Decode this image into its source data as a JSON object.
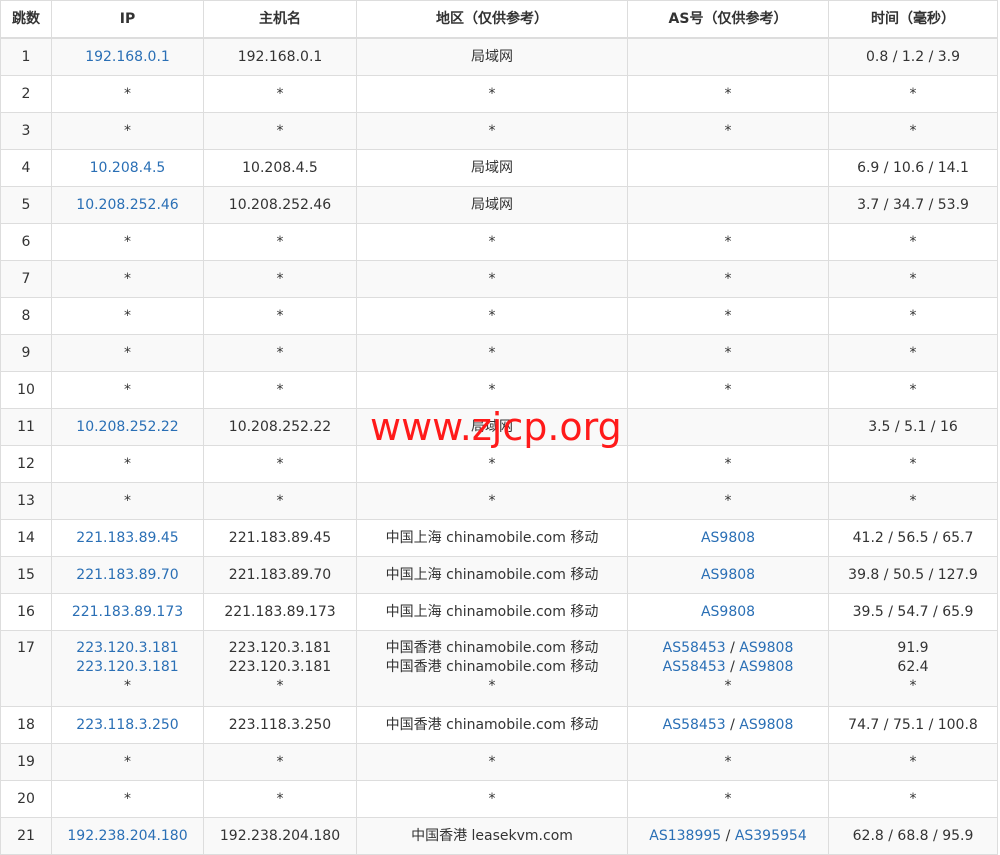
{
  "headers": [
    "跳数",
    "IP",
    "主机名",
    "地区（仅供参考）",
    "AS号（仅供参考）",
    "时间（毫秒）"
  ],
  "watermark": "www.zjcp.org",
  "rows": [
    {
      "hop": "1",
      "ips": [
        "192.168.0.1"
      ],
      "hosts": [
        "192.168.0.1"
      ],
      "regions": [
        "局域网"
      ],
      "as": [
        []
      ],
      "times": [
        "0.8 / 1.2 / 3.9"
      ]
    },
    {
      "hop": "2",
      "ips": [
        "*"
      ],
      "hosts": [
        "*"
      ],
      "regions": [
        "*"
      ],
      "as": [
        [
          "*"
        ]
      ],
      "times": [
        "*"
      ]
    },
    {
      "hop": "3",
      "ips": [
        "*"
      ],
      "hosts": [
        "*"
      ],
      "regions": [
        "*"
      ],
      "as": [
        [
          "*"
        ]
      ],
      "times": [
        "*"
      ]
    },
    {
      "hop": "4",
      "ips": [
        "10.208.4.5"
      ],
      "hosts": [
        "10.208.4.5"
      ],
      "regions": [
        "局域网"
      ],
      "as": [
        []
      ],
      "times": [
        "6.9 / 10.6 / 14.1"
      ]
    },
    {
      "hop": "5",
      "ips": [
        "10.208.252.46"
      ],
      "hosts": [
        "10.208.252.46"
      ],
      "regions": [
        "局域网"
      ],
      "as": [
        []
      ],
      "times": [
        "3.7 / 34.7 / 53.9"
      ]
    },
    {
      "hop": "6",
      "ips": [
        "*"
      ],
      "hosts": [
        "*"
      ],
      "regions": [
        "*"
      ],
      "as": [
        [
          "*"
        ]
      ],
      "times": [
        "*"
      ]
    },
    {
      "hop": "7",
      "ips": [
        "*"
      ],
      "hosts": [
        "*"
      ],
      "regions": [
        "*"
      ],
      "as": [
        [
          "*"
        ]
      ],
      "times": [
        "*"
      ]
    },
    {
      "hop": "8",
      "ips": [
        "*"
      ],
      "hosts": [
        "*"
      ],
      "regions": [
        "*"
      ],
      "as": [
        [
          "*"
        ]
      ],
      "times": [
        "*"
      ]
    },
    {
      "hop": "9",
      "ips": [
        "*"
      ],
      "hosts": [
        "*"
      ],
      "regions": [
        "*"
      ],
      "as": [
        [
          "*"
        ]
      ],
      "times": [
        "*"
      ]
    },
    {
      "hop": "10",
      "ips": [
        "*"
      ],
      "hosts": [
        "*"
      ],
      "regions": [
        "*"
      ],
      "as": [
        [
          "*"
        ]
      ],
      "times": [
        "*"
      ]
    },
    {
      "hop": "11",
      "ips": [
        "10.208.252.22"
      ],
      "hosts": [
        "10.208.252.22"
      ],
      "regions": [
        "局域网"
      ],
      "as": [
        []
      ],
      "times": [
        "3.5 / 5.1 / 16"
      ]
    },
    {
      "hop": "12",
      "ips": [
        "*"
      ],
      "hosts": [
        "*"
      ],
      "regions": [
        "*"
      ],
      "as": [
        [
          "*"
        ]
      ],
      "times": [
        "*"
      ]
    },
    {
      "hop": "13",
      "ips": [
        "*"
      ],
      "hosts": [
        "*"
      ],
      "regions": [
        "*"
      ],
      "as": [
        [
          "*"
        ]
      ],
      "times": [
        "*"
      ]
    },
    {
      "hop": "14",
      "ips": [
        "221.183.89.45"
      ],
      "hosts": [
        "221.183.89.45"
      ],
      "regions": [
        "中国上海 chinamobile.com 移动"
      ],
      "as": [
        [
          "AS9808"
        ]
      ],
      "times": [
        "41.2 / 56.5 / 65.7"
      ]
    },
    {
      "hop": "15",
      "ips": [
        "221.183.89.70"
      ],
      "hosts": [
        "221.183.89.70"
      ],
      "regions": [
        "中国上海 chinamobile.com 移动"
      ],
      "as": [
        [
          "AS9808"
        ]
      ],
      "times": [
        "39.8 / 50.5 / 127.9"
      ]
    },
    {
      "hop": "16",
      "ips": [
        "221.183.89.173"
      ],
      "hosts": [
        "221.183.89.173"
      ],
      "regions": [
        "中国上海 chinamobile.com 移动"
      ],
      "as": [
        [
          "AS9808"
        ]
      ],
      "times": [
        "39.5 / 54.7 / 65.9"
      ]
    },
    {
      "hop": "17",
      "ips": [
        "223.120.3.181",
        "223.120.3.181",
        "*"
      ],
      "hosts": [
        "223.120.3.181",
        "223.120.3.181",
        "*"
      ],
      "regions": [
        "中国香港 chinamobile.com 移动",
        "中国香港 chinamobile.com 移动",
        "*"
      ],
      "as": [
        [
          "AS58453",
          "AS9808"
        ],
        [
          "AS58453",
          "AS9808"
        ],
        [
          "*"
        ]
      ],
      "times": [
        "91.9",
        "62.4",
        "*"
      ]
    },
    {
      "hop": "18",
      "ips": [
        "223.118.3.250"
      ],
      "hosts": [
        "223.118.3.250"
      ],
      "regions": [
        "中国香港 chinamobile.com 移动"
      ],
      "as": [
        [
          "AS58453",
          "AS9808"
        ]
      ],
      "times": [
        "74.7 / 75.1 / 100.8"
      ]
    },
    {
      "hop": "19",
      "ips": [
        "*"
      ],
      "hosts": [
        "*"
      ],
      "regions": [
        "*"
      ],
      "as": [
        [
          "*"
        ]
      ],
      "times": [
        "*"
      ]
    },
    {
      "hop": "20",
      "ips": [
        "*"
      ],
      "hosts": [
        "*"
      ],
      "regions": [
        "*"
      ],
      "as": [
        [
          "*"
        ]
      ],
      "times": [
        "*"
      ]
    },
    {
      "hop": "21",
      "ips": [
        "192.238.204.180"
      ],
      "hosts": [
        "192.238.204.180"
      ],
      "regions": [
        "中国香港 leasekvm.com"
      ],
      "as": [
        [
          "AS138995",
          "AS395954"
        ]
      ],
      "times": [
        "62.8 / 68.8 / 95.9"
      ]
    }
  ]
}
